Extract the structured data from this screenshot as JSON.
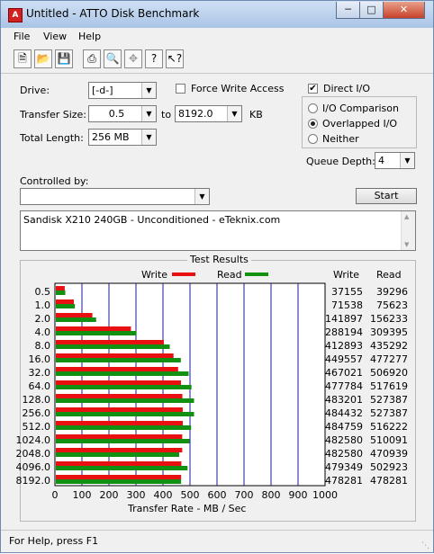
{
  "window": {
    "title": "Untitled - ATTO Disk Benchmark",
    "app_icon": "A"
  },
  "menu": {
    "file": "File",
    "view": "View",
    "help": "Help"
  },
  "toolbar": {
    "icons": [
      "new-doc-icon",
      "open-folder-icon",
      "save-icon",
      "print-icon",
      "print-preview-icon",
      "move-icon",
      "help-icon",
      "context-help-icon"
    ]
  },
  "settings": {
    "drive_label": "Drive:",
    "drive_value": "[-d-]",
    "force_write_label": "Force Write Access",
    "force_write_checked": false,
    "direct_io_label": "Direct I/O",
    "direct_io_checked": true,
    "transfer_size_label": "Transfer Size:",
    "transfer_from": "0.5",
    "to_label": "to",
    "transfer_to": "8192.0",
    "kb_label": "KB",
    "total_length_label": "Total Length:",
    "total_length_value": "256 MB",
    "io_comparison_label": "I/O Comparison",
    "overlapped_io_label": "Overlapped I/O",
    "neither_label": "Neither",
    "selected_io_mode": "Overlapped I/O",
    "queue_depth_label": "Queue Depth:",
    "queue_depth_value": "4",
    "controlled_by_label": "Controlled by:",
    "controlled_by_value": "",
    "start_button": "Start",
    "description": "Sandisk X210 240GB - Unconditioned - eTeknix.com"
  },
  "results": {
    "group_title": "Test Results",
    "legend_write": "Write",
    "legend_read": "Read",
    "col_write": "Write",
    "col_read": "Read",
    "rows": [
      {
        "size": "0.5",
        "write": "37155",
        "read": "39296"
      },
      {
        "size": "1.0",
        "write": "71538",
        "read": "75623"
      },
      {
        "size": "2.0",
        "write": "141897",
        "read": "156233"
      },
      {
        "size": "4.0",
        "write": "288194",
        "read": "309395"
      },
      {
        "size": "8.0",
        "write": "412893",
        "read": "435292"
      },
      {
        "size": "16.0",
        "write": "449557",
        "read": "477277"
      },
      {
        "size": "32.0",
        "write": "467021",
        "read": "506920"
      },
      {
        "size": "64.0",
        "write": "477784",
        "read": "517619"
      },
      {
        "size": "128.0",
        "write": "483201",
        "read": "527387"
      },
      {
        "size": "256.0",
        "write": "484432",
        "read": "527387"
      },
      {
        "size": "512.0",
        "write": "484759",
        "read": "516222"
      },
      {
        "size": "1024.0",
        "write": "482580",
        "read": "510091"
      },
      {
        "size": "2048.0",
        "write": "482580",
        "read": "470939"
      },
      {
        "size": "4096.0",
        "write": "479349",
        "read": "502923"
      },
      {
        "size": "8192.0",
        "write": "478281",
        "read": "478281"
      }
    ]
  },
  "chart_data": {
    "type": "bar",
    "orientation": "horizontal",
    "categories": [
      "0.5",
      "1.0",
      "2.0",
      "4.0",
      "8.0",
      "16.0",
      "32.0",
      "64.0",
      "128.0",
      "256.0",
      "512.0",
      "1024.0",
      "2048.0",
      "4096.0",
      "8192.0"
    ],
    "series": [
      {
        "name": "Write",
        "color": "#e81010",
        "values": [
          36.3,
          69.9,
          138.6,
          281.4,
          403.2,
          439.0,
          456.1,
          466.6,
          471.9,
          473.1,
          473.4,
          471.3,
          471.3,
          468.1,
          467.1
        ]
      },
      {
        "name": "Read",
        "color": "#119011",
        "values": [
          38.4,
          73.9,
          152.6,
          302.1,
          425.1,
          466.1,
          495.0,
          505.5,
          515.0,
          515.0,
          504.1,
          498.1,
          459.9,
          491.1,
          467.1
        ]
      }
    ],
    "xlabel": "Transfer Rate - MB / Sec",
    "xlim": [
      0,
      1000
    ],
    "ticks": [
      "0",
      "100",
      "200",
      "300",
      "400",
      "500",
      "600",
      "700",
      "800",
      "900",
      "1000"
    ],
    "grid": true,
    "legend": "top"
  },
  "status": {
    "text": "For Help, press F1"
  }
}
